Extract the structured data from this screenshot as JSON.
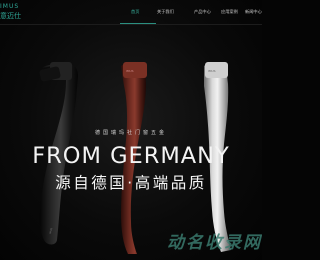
{
  "brand": {
    "logo_en": "IMUS",
    "logo_cn": "意迈仕"
  },
  "nav": {
    "items": [
      {
        "label": "首页",
        "active": true
      },
      {
        "label": "关于我们",
        "active": false
      },
      {
        "label": "产品中心",
        "active": false
      },
      {
        "label": "应用案例",
        "active": false
      },
      {
        "label": "新闻中心",
        "active": false
      }
    ]
  },
  "hero": {
    "tagline": "德国瑞玛社门窗五金",
    "headline": "FROM GERMANY",
    "subheadline": "源自德国·高端品质",
    "handle_colors": [
      "#141414",
      "#6a2a20",
      "#b9b9b9"
    ]
  },
  "watermark": "动名收录网",
  "colors": {
    "accent": "#2fa898",
    "background": "#050505"
  }
}
